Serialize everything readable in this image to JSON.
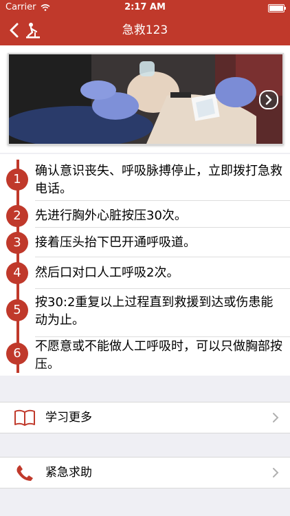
{
  "status": {
    "carrier": "Carrier",
    "time": "2:17 AM"
  },
  "nav": {
    "title": "急救123"
  },
  "steps": [
    {
      "num": "1",
      "text": "确认意识丧失、呼吸脉搏停止，立即拨打急救电话。"
    },
    {
      "num": "2",
      "text": "先进行胸外心脏按压30次。"
    },
    {
      "num": "3",
      "text": "接着压头抬下巴开通呼吸道。"
    },
    {
      "num": "4",
      "text": "然后口对口人工呼吸2次。"
    },
    {
      "num": "5",
      "text": "按30:2重复以上过程直到救援到达或伤患能动为止。"
    },
    {
      "num": "6",
      "text": "不愿意或不能做人工呼吸时，可以只做胸部按压。"
    }
  ],
  "menu": {
    "learn_more": "学习更多",
    "emergency": "紧急求助"
  },
  "colors": {
    "accent": "#c0392b",
    "background": "#efeff4"
  }
}
